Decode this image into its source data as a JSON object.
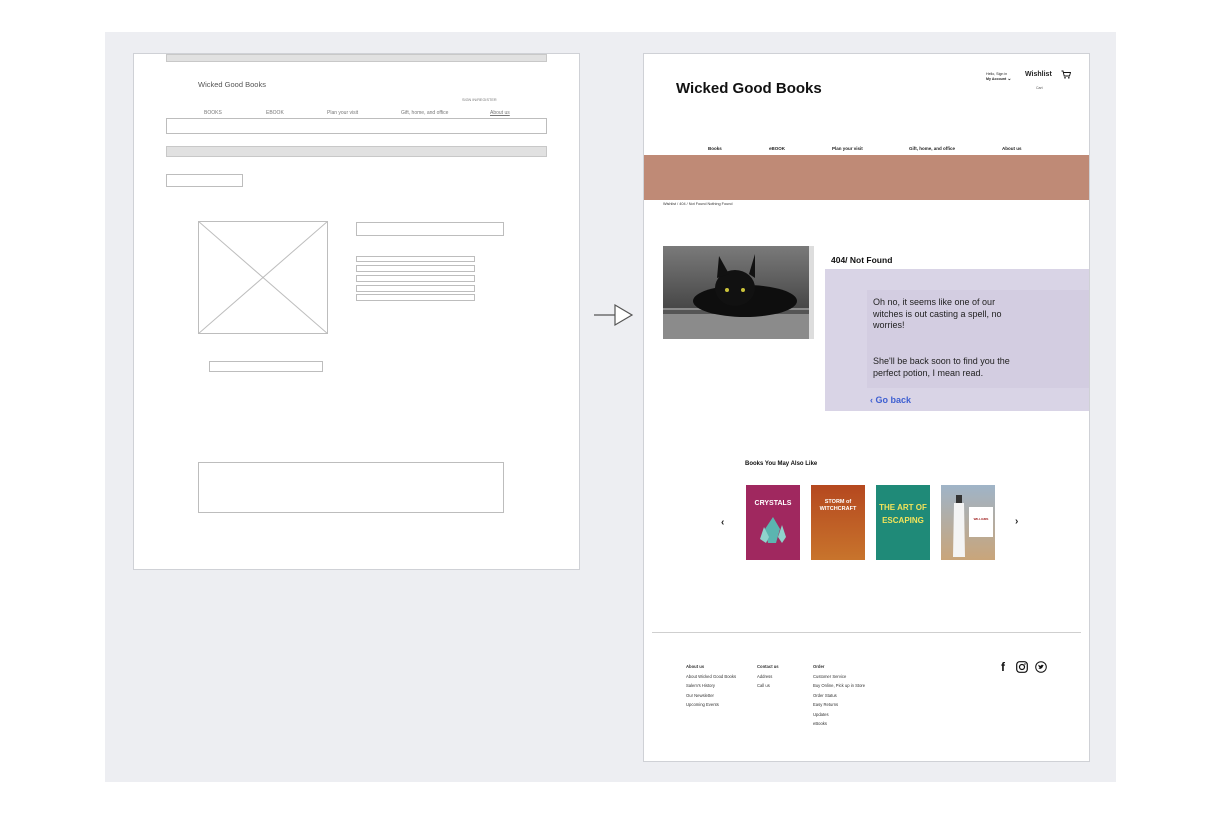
{
  "wireframe": {
    "site_title": "Wicked Good Books",
    "sign_in": "SIGN IN/REGISTER",
    "nav": [
      "BOOKS",
      "EBOOK",
      "Plan your visit",
      "Gift, home, and office",
      "About us"
    ]
  },
  "mockup": {
    "site_title": "Wicked Good Books",
    "account": {
      "hello": "Hello, Sign in",
      "my_account": "My Account",
      "wishlist": "Wishlist",
      "cart": "Cart"
    },
    "nav": [
      "Books",
      "eBOOK",
      "Plan your visit",
      "Gift, home, and office",
      "About us"
    ],
    "breadcrumb": "Wishlist / 404 / Not Found Nothing Found",
    "error": {
      "title": "404/ Not Found",
      "line1": "Oh no, it seems like one of our witches is out casting a spell, no worries!",
      "line2": "She'll be back soon to find you the perfect potion, I mean read.",
      "go_back": "Go back"
    },
    "recommend": {
      "heading": "Books You May Also Like",
      "books": [
        {
          "title": "CRYSTALS",
          "color": "#a0285f"
        },
        {
          "title": "STORM of WITCHCRAFT",
          "color": "#b5481f"
        },
        {
          "title": "THE ART OF ESCAPING",
          "color": "#1f8a78"
        },
        {
          "title": "WILLIAMS",
          "color": "#9fb4c8"
        }
      ]
    },
    "footer": {
      "col1": {
        "heading": "About us",
        "items": [
          "About Wicked Good Books",
          "Salem's History",
          "Our Newsletter",
          "Upcoming Events"
        ]
      },
      "col2": {
        "heading": "Contact us",
        "items": [
          "Address",
          "Call us"
        ]
      },
      "col3": {
        "heading": "Order",
        "items": [
          "Customer Service",
          "Buy Online, Pick up in Store",
          "Order Status",
          "Easy Returns",
          "Updates",
          "eBooks"
        ]
      },
      "social": [
        "facebook-icon",
        "instagram-icon",
        "twitter-icon"
      ]
    },
    "colors": {
      "banner": "#bf8a76",
      "panel": "#d9d4e6",
      "panel_inner": "#d3cde1",
      "link": "#3e5fd1"
    }
  }
}
